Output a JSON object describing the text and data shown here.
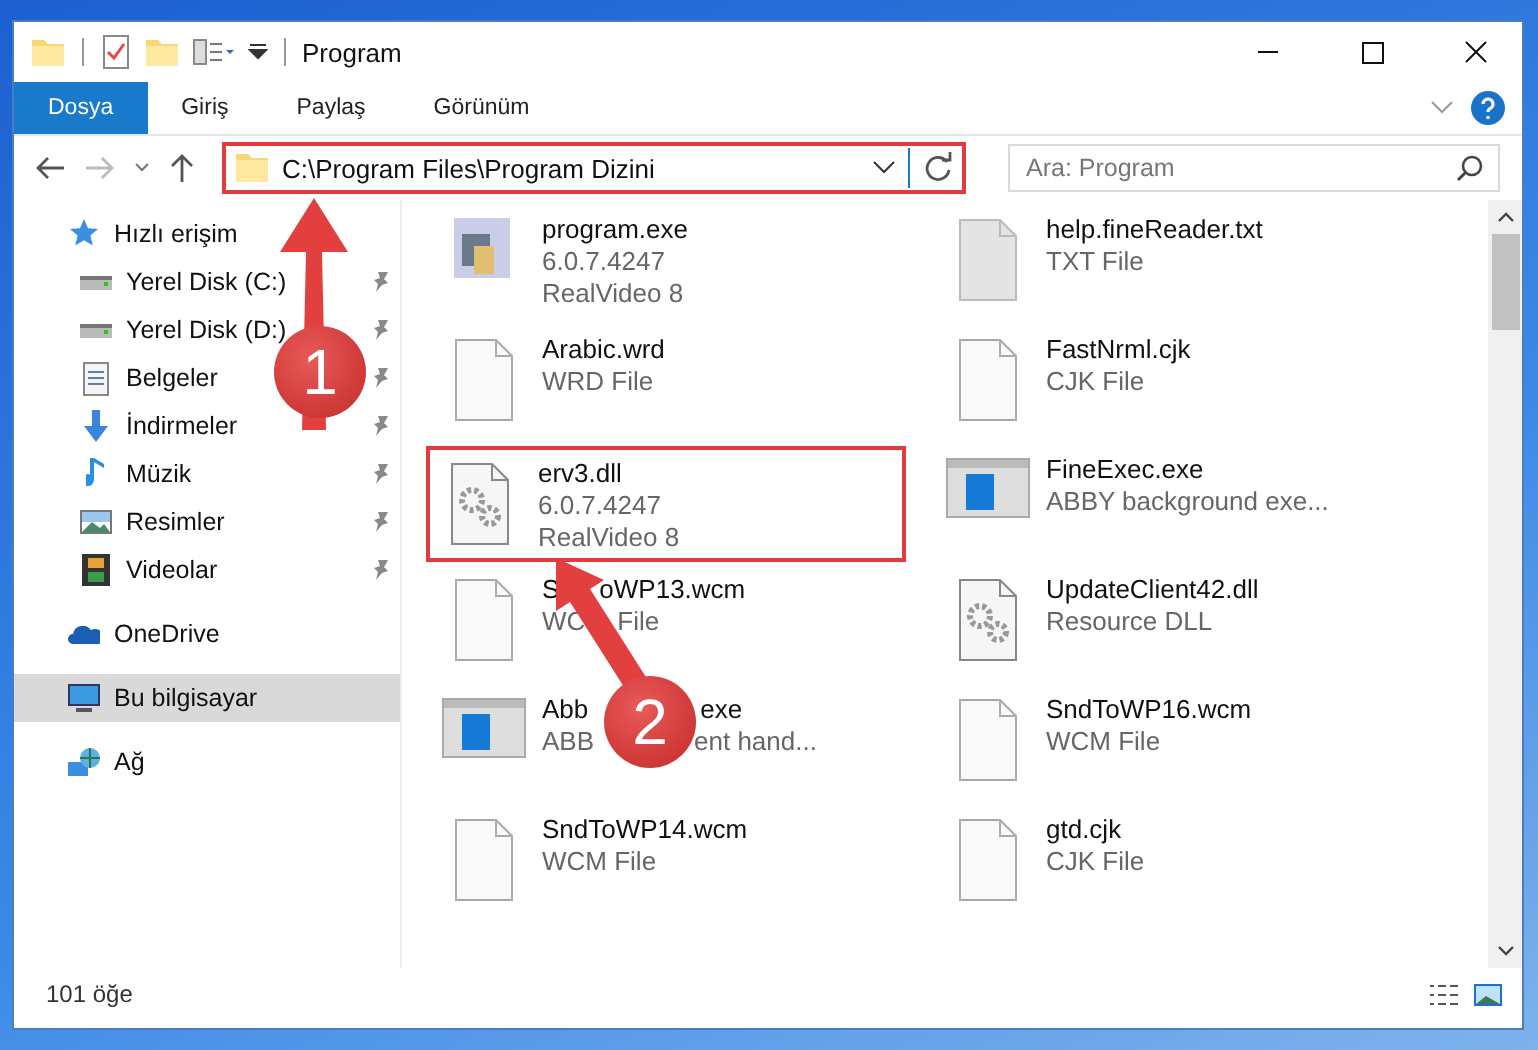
{
  "window": {
    "title": "Program"
  },
  "ribbon": {
    "tabs": [
      {
        "label": "Dosya",
        "selected": true
      },
      {
        "label": "Giriş",
        "selected": false
      },
      {
        "label": "Paylaş",
        "selected": false
      },
      {
        "label": "Görünüm",
        "selected": false
      }
    ]
  },
  "address_bar": {
    "value": "C:\\Program Files\\Program Dizini",
    "highlighted": true
  },
  "search": {
    "placeholder": "Ara: Program"
  },
  "sidebar": {
    "items": [
      {
        "label": "Hızlı erişim",
        "kind": "star",
        "selected": false,
        "children": [
          {
            "label": "Yerel Disk (C:)",
            "kind": "disk",
            "pinned": true,
            "selected": false
          },
          {
            "label": "Yerel Disk (D:)",
            "kind": "disk",
            "pinned": true,
            "selected": false
          },
          {
            "label": "Belgeler",
            "kind": "documents",
            "pinned": true,
            "selected": false
          },
          {
            "label": "İndirmeler",
            "kind": "download",
            "pinned": true,
            "selected": false
          },
          {
            "label": "Müzik",
            "kind": "music",
            "pinned": true,
            "selected": false
          },
          {
            "label": "Resimler",
            "kind": "pictures",
            "pinned": true,
            "selected": false
          },
          {
            "label": "Videolar",
            "kind": "videos",
            "pinned": true,
            "selected": false
          }
        ]
      },
      {
        "label": "OneDrive",
        "kind": "cloud",
        "selected": false
      },
      {
        "label": "Bu bilgisayar",
        "kind": "computer",
        "selected": true
      },
      {
        "label": "Ağ",
        "kind": "network",
        "selected": false
      }
    ]
  },
  "files": [
    {
      "name": [
        "program.exe"
      ],
      "lines": [
        [
          "6.0.7.4247"
        ],
        [
          "RealVideo 8"
        ]
      ],
      "kind": "app",
      "highlighted": false
    },
    {
      "name": [
        "help.fineReader.txt"
      ],
      "lines": [
        [
          "TXT File"
        ]
      ],
      "kind": "grey-doc",
      "highlighted": false
    },
    {
      "name": [
        "Arabic.wrd"
      ],
      "lines": [
        [
          "WRD File"
        ]
      ],
      "kind": "doc",
      "highlighted": false
    },
    {
      "name": [
        "FastNrml.cjk"
      ],
      "lines": [
        [
          "CJK File"
        ]
      ],
      "kind": "doc",
      "highlighted": false
    },
    {
      "name": [
        "erv3.dll"
      ],
      "lines": [
        [
          "6.0.7.4247"
        ],
        [
          "RealVideo 8"
        ]
      ],
      "kind": "gear",
      "highlighted": true
    },
    {
      "name": [
        "FineExec.exe"
      ],
      "lines": [
        [
          "ABBY background exe..."
        ]
      ],
      "kind": "window",
      "highlighted": false
    },
    {
      "name": [
        "S",
        "oWP13.wcm"
      ],
      "lines": [
        [
          "WC",
          "File"
        ]
      ],
      "kind": "doc",
      "highlighted": false
    },
    {
      "name": [
        "UpdateClient42.dll"
      ],
      "lines": [
        [
          "Resource DLL"
        ]
      ],
      "kind": "gear",
      "highlighted": false
    },
    {
      "name": [
        "Abb",
        "exe"
      ],
      "lines": [
        [
          "ABB",
          "ent hand..."
        ]
      ],
      "kind": "window",
      "highlighted": false
    },
    {
      "name": [
        "SndToWP16.wcm"
      ],
      "lines": [
        [
          "WCM File"
        ]
      ],
      "kind": "doc",
      "highlighted": false
    },
    {
      "name": [
        "SndToWP14.wcm"
      ],
      "lines": [
        [
          "WCM File"
        ]
      ],
      "kind": "doc",
      "highlighted": false
    },
    {
      "name": [
        "gtd.cjk"
      ],
      "lines": [
        [
          "CJK File"
        ]
      ],
      "kind": "doc",
      "highlighted": false
    }
  ],
  "status_bar": {
    "count": "101 öğe"
  },
  "callouts": [
    {
      "number": "1"
    },
    {
      "number": "2"
    }
  ]
}
